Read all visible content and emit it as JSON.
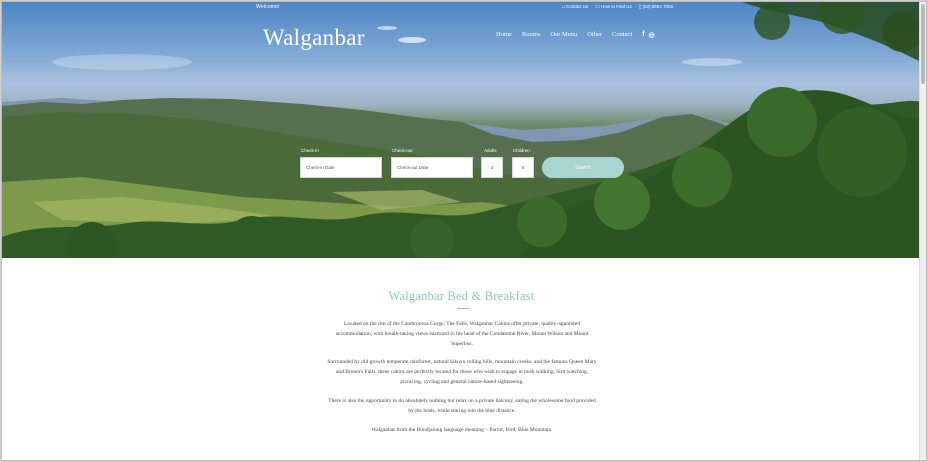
{
  "header": {
    "welcome": "Welcome!",
    "contact_us": "Contact Us",
    "how_to_find": "How to Find Us",
    "phone": "(02) 6684 7000",
    "logo": "Walganbar",
    "nav": [
      "Home",
      "Rooms",
      "Our Menu",
      "Other",
      "Contact"
    ],
    "social": [
      "f",
      "◎"
    ]
  },
  "booking": {
    "checkin_label": "Check-in",
    "checkin_placeholder": "Check-in Date",
    "checkout_label": "Check-out",
    "checkout_placeholder": "Check-out Date",
    "adults_label": "Adults",
    "adults_value": "2",
    "children_label": "Children",
    "children_value": "0",
    "search_label": "Search"
  },
  "content": {
    "heading": "Walganbar Bed & Breakfast",
    "paragraphs": [
      "Located on the rim of the Cambrooroa Gorge, The Falls, Walganbar Cabins offer private, quality-appointed accommodation, with breath-taking views eastward to the head of the Condamine River, Mount Wilson and Mount Superbus.",
      "Surrounded by old growth temperate rainforest, natural kikuyu rolling hills, mountain creeks, and the famous Queen Mary and Brown's Falls, these cabins are perfectly located for those who wish to engage in bush walking, bird watching, picnicing, cycling and general nature-based sightseeing.",
      "There is also the opportunity to do absolutely nothing but relax on a private balcony, eating the wholesome food provided by the hosts, while staring into the blue distance.",
      "Walganbar from the Bundjalung language meaning – Parrot, Bird, Blue Mountain."
    ]
  },
  "colors": {
    "accent": "#8cc6c0",
    "button": "#a9d5d0"
  }
}
